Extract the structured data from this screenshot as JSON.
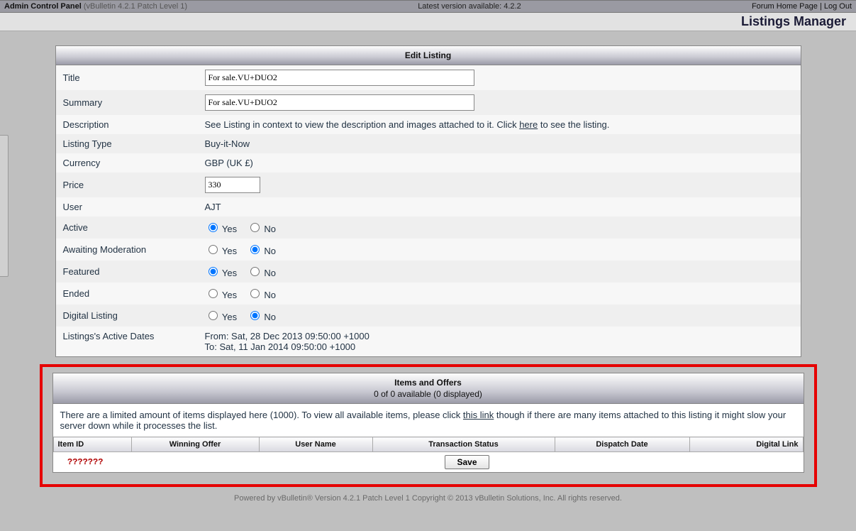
{
  "topbar": {
    "title_bold": "Admin Control Panel",
    "version": "(vBulletin 4.2.1 Patch Level 1)",
    "latest": "Latest version available: 4.2.2",
    "link_home": "Forum Home Page",
    "link_logout": "Log Out"
  },
  "section_title": "Listings Manager",
  "edit": {
    "panel_title": "Edit Listing",
    "rows": {
      "title_label": "Title",
      "title_value": "For sale.VU+DUO2",
      "summary_label": "Summary",
      "summary_value": "For sale.VU+DUO2",
      "description_label": "Description",
      "description_text_pre": "See Listing in context to view the description and images attached to it. Click ",
      "description_link": "here",
      "description_text_post": " to see the listing.",
      "listing_type_label": "Listing Type",
      "listing_type_value": "Buy-it-Now",
      "currency_label": "Currency",
      "currency_value": "GBP (UK £)",
      "price_label": "Price",
      "price_value": "330",
      "user_label": "User",
      "user_value": "AJT",
      "active_label": "Active",
      "await_label": "Awaiting Moderation",
      "featured_label": "Featured",
      "ended_label": "Ended",
      "digital_label": "Digital Listing",
      "dates_label": "Listings's Active Dates",
      "dates_from": "From: Sat, 28 Dec 2013 09:50:00 +1000",
      "dates_to": "To: Sat, 11 Jan 2014 09:50:00 +1000",
      "yes": "Yes",
      "no": "No"
    }
  },
  "items": {
    "panel_title": "Items and Offers",
    "panel_sub": "0 of 0 available (0 displayed)",
    "note_pre": "There are a limited amount of items displayed here (1000). To view all available items, please click ",
    "note_link": "this link",
    "note_post": " though if there are many items attached to this listing it might slow your server down while it processes the list.",
    "headers": {
      "item_id": "Item ID",
      "winning_offer": "Winning Offer",
      "user_name": "User Name",
      "transaction_status": "Transaction Status",
      "dispatch_date": "Dispatch Date",
      "digital_link": "Digital Link"
    },
    "qmarks": "???????",
    "save": "Save"
  },
  "footer": "Powered by vBulletin® Version 4.2.1 Patch Level 1 Copyright © 2013 vBulletin Solutions, Inc. All rights reserved."
}
